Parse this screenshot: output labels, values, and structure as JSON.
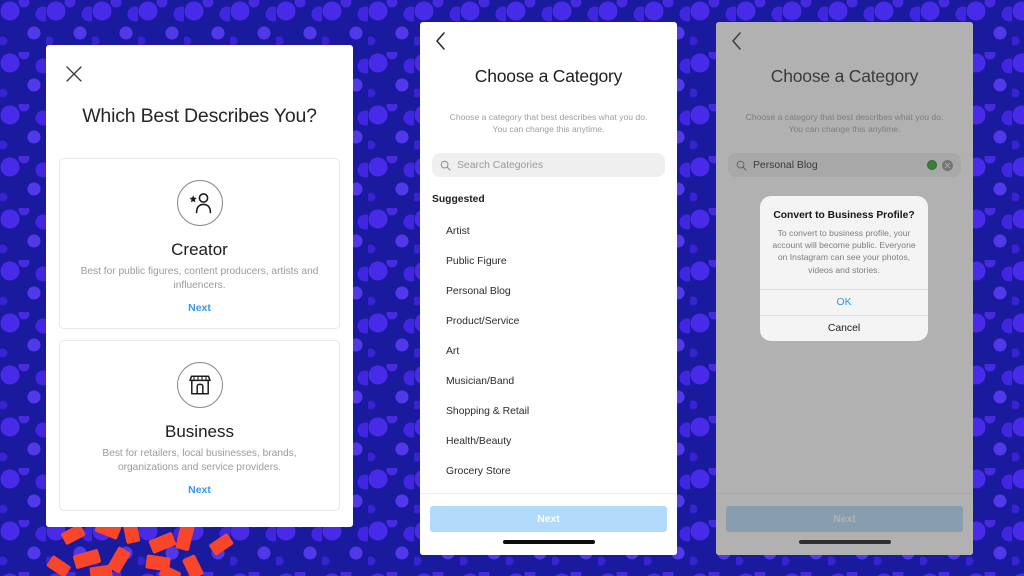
{
  "background": {
    "base_color": "#1a1a9e",
    "dot_color": "#4b2df0",
    "confetti_color": "#f9452a"
  },
  "screen1": {
    "close_icon": "close-icon",
    "title": "Which Best Describes You?",
    "cards": [
      {
        "icon": "creator-person-star-icon",
        "title": "Creator",
        "description": "Best for public figures, content producers, artists and influencers.",
        "next_label": "Next"
      },
      {
        "icon": "business-storefront-icon",
        "title": "Business",
        "description": "Best for retailers, local businesses, brands, organizations and service providers.",
        "next_label": "Next"
      }
    ]
  },
  "screen2": {
    "back_icon": "back-chevron-icon",
    "title": "Choose a Category",
    "subtitle": "Choose a category that best describes what you do. You can change this anytime.",
    "search": {
      "icon": "search-icon",
      "placeholder": "Search Categories",
      "value": ""
    },
    "section_label": "Suggested",
    "categories": [
      "Artist",
      "Public Figure",
      "Personal Blog",
      "Product/Service",
      "Art",
      "Musician/Band",
      "Shopping & Retail",
      "Health/Beauty",
      "Grocery Store"
    ],
    "next_label": "Next",
    "next_color": "#b2dafa"
  },
  "screen3": {
    "back_icon": "back-chevron-icon",
    "title": "Choose a Category",
    "subtitle": "Choose a category that best describes what you do. You can change this anytime.",
    "search": {
      "icon": "search-icon",
      "value": "Personal Blog",
      "cursor_indicator": "green-dot-indicator",
      "clear_icon": "clear-circle-icon"
    },
    "next_label": "Next",
    "next_color": "#b2dafa",
    "alert": {
      "title": "Convert to Business Profile?",
      "message": "To convert to business profile, your account will become public. Everyone on Instagram can see your photos, videos and stories.",
      "ok_label": "OK",
      "cancel_label": "Cancel",
      "ok_color": "#2f95e8"
    }
  }
}
